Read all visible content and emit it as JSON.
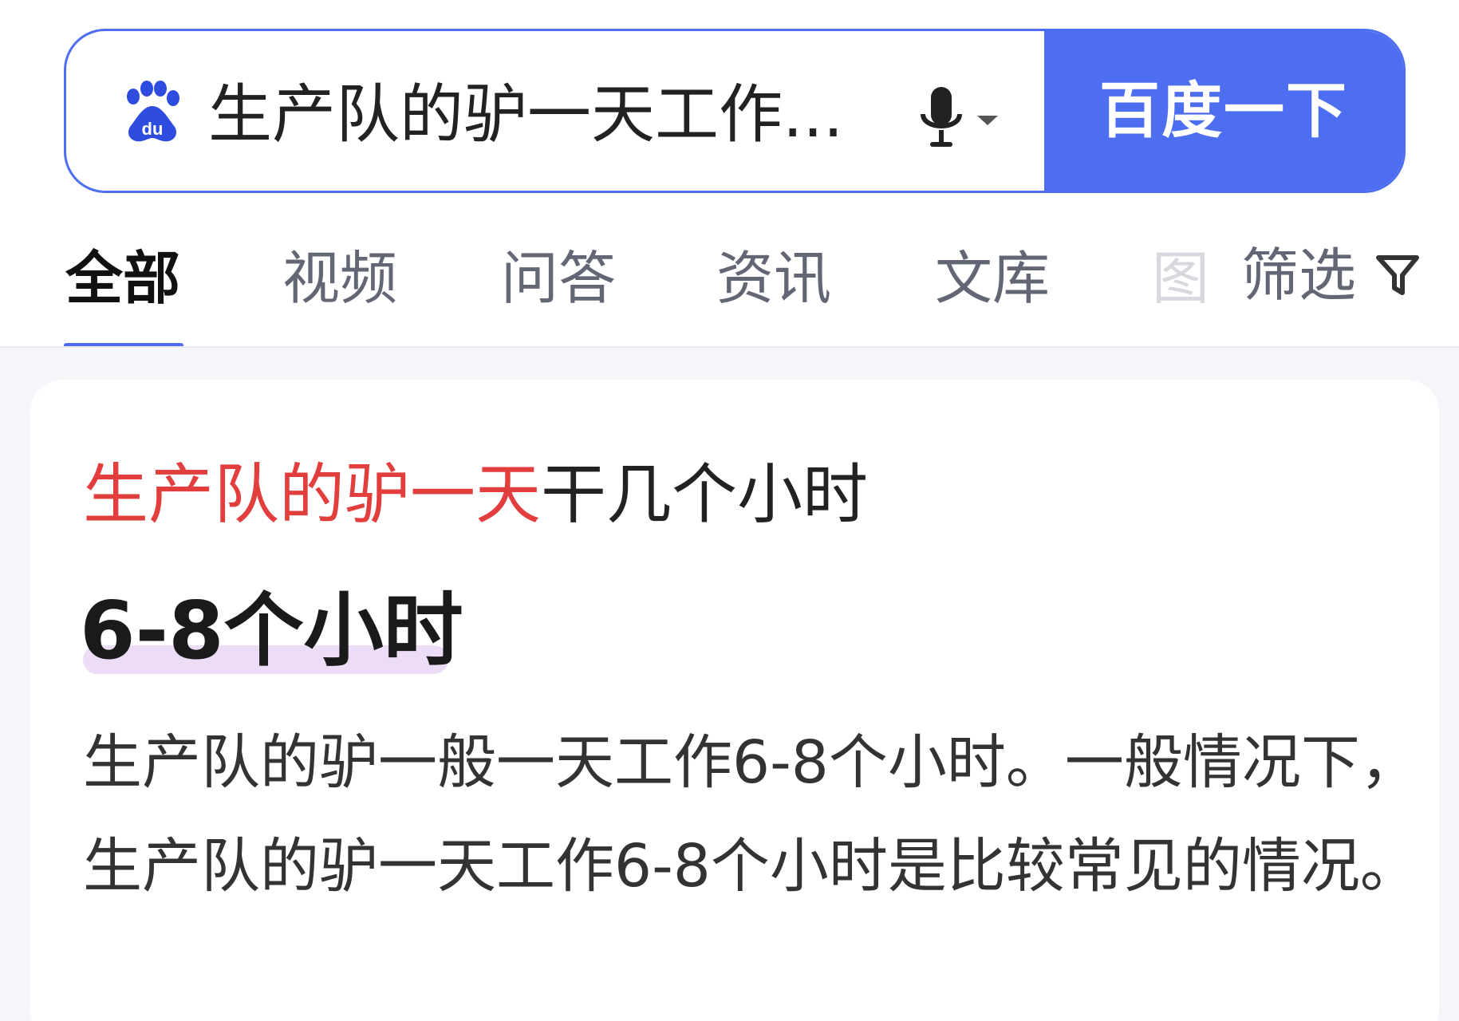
{
  "search": {
    "query": "生产队的驴一天工作...",
    "button_label": "百度一下"
  },
  "tabs": [
    {
      "label": "全部",
      "active": true
    },
    {
      "label": "视频"
    },
    {
      "label": "问答"
    },
    {
      "label": "资讯"
    },
    {
      "label": "文库"
    },
    {
      "label": "图"
    }
  ],
  "filter": {
    "label": "筛选"
  },
  "result": {
    "title_highlight": "生产队的驴一天",
    "title_rest": "干几个小时",
    "answer": "6-8个小时",
    "abstract": "生产队的驴一般一天工作6-8个小时。一般情况下，生产队的驴一天工作6-8个小时是比较常见的情况。"
  },
  "colors": {
    "brand_blue": "#4e6ef2",
    "highlight_red": "#e23e3e",
    "answer_underline": "#ecdcf6"
  },
  "icons": {
    "logo": "baidu-paw-icon",
    "voice": "microphone-icon",
    "voice_menu": "caret-down-icon",
    "filter": "funnel-icon"
  }
}
